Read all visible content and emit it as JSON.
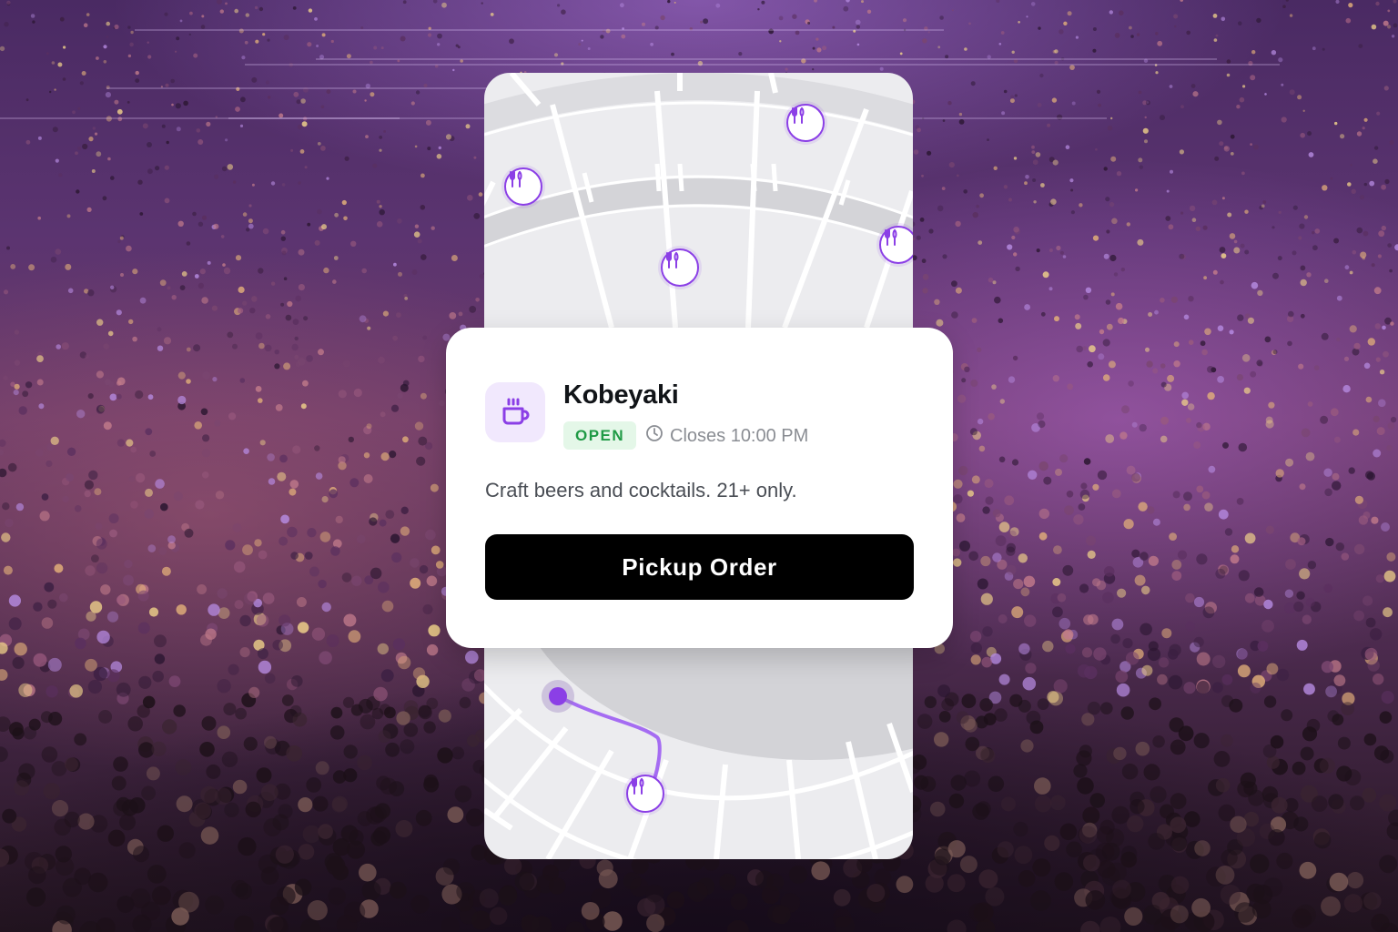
{
  "venue": {
    "icon": "coffee-cup-icon",
    "name": "Kobeyaki",
    "status": "OPEN",
    "hours_icon": "clock-icon",
    "hours": "Closes 10:00 PM",
    "description": "Craft beers and cocktails. 21+ only."
  },
  "action": {
    "label": "Pickup Order"
  },
  "map": {
    "marker_icon": "fork-knife-icon",
    "route_color": "#a56cf2",
    "accent": "#8b3fe6"
  },
  "colors": {
    "status_bg": "#e4f7e8",
    "status_text": "#1f9a45",
    "icon_bg": "#f1e8fd",
    "button_bg": "#000000"
  }
}
